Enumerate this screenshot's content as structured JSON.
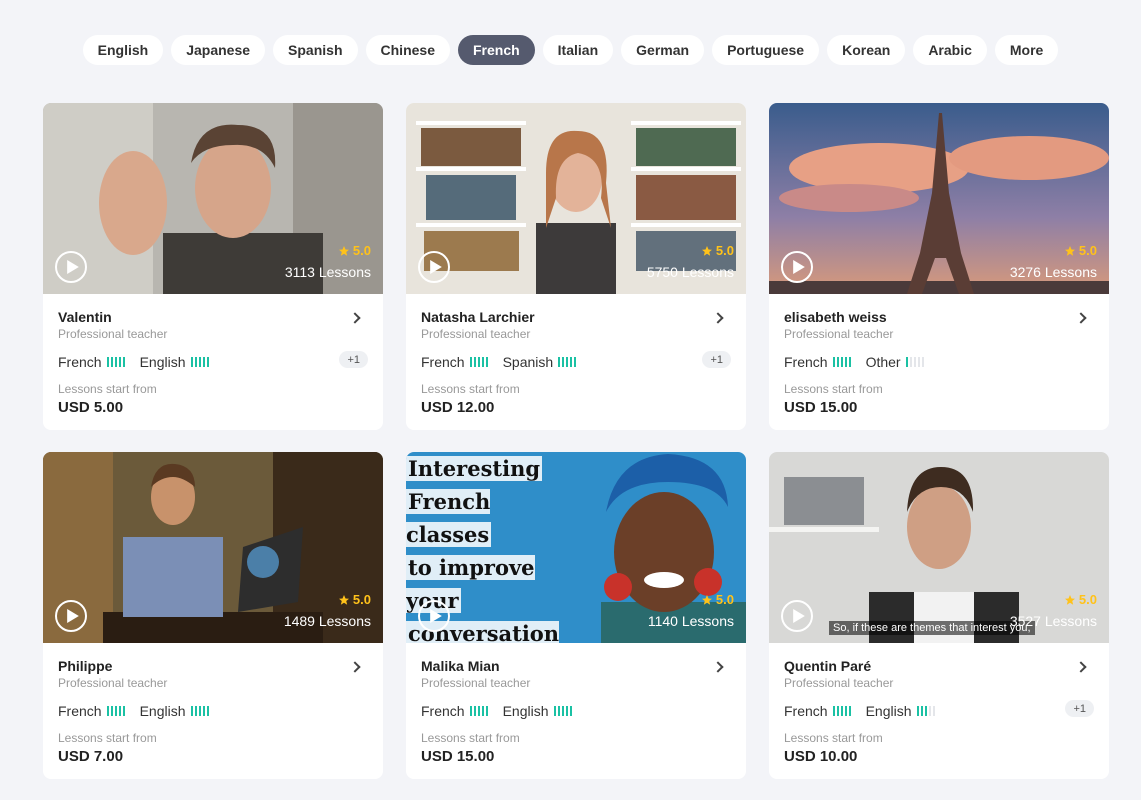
{
  "languages": [
    {
      "label": "English",
      "active": false
    },
    {
      "label": "Japanese",
      "active": false
    },
    {
      "label": "Spanish",
      "active": false
    },
    {
      "label": "Chinese",
      "active": false
    },
    {
      "label": "French",
      "active": true
    },
    {
      "label": "Italian",
      "active": false
    },
    {
      "label": "German",
      "active": false
    },
    {
      "label": "Portuguese",
      "active": false
    },
    {
      "label": "Korean",
      "active": false
    },
    {
      "label": "Arabic",
      "active": false
    },
    {
      "label": "More",
      "active": false
    }
  ],
  "colors": {
    "accent": "#1bc1a4",
    "active_pill": "#555a6e",
    "rating": "#ffc21a"
  },
  "teachers": [
    {
      "name": "Valentin",
      "title": "Professional teacher",
      "rating": "5.0",
      "lessons": "3113 Lessons",
      "languages": [
        {
          "label": "French",
          "level": 5
        },
        {
          "label": "English",
          "level": 5
        }
      ],
      "extra": "+1",
      "from_label": "Lessons start from",
      "price": "USD 5.00"
    },
    {
      "name": "Natasha Larchier",
      "title": "Professional teacher",
      "rating": "5.0",
      "lessons": "5750 Lessons",
      "languages": [
        {
          "label": "French",
          "level": 5
        },
        {
          "label": "Spanish",
          "level": 5
        }
      ],
      "extra": "+1",
      "from_label": "Lessons start from",
      "price": "USD 12.00"
    },
    {
      "name": "elisabeth weiss",
      "title": "Professional teacher",
      "rating": "5.0",
      "lessons": "3276 Lessons",
      "languages": [
        {
          "label": "French",
          "level": 5
        },
        {
          "label": "Other",
          "level": 1
        }
      ],
      "extra": "",
      "from_label": "Lessons start from",
      "price": "USD 15.00"
    },
    {
      "name": "Philippe",
      "title": "Professional teacher",
      "rating": "5.0",
      "lessons": "1489 Lessons",
      "languages": [
        {
          "label": "French",
          "level": 5
        },
        {
          "label": "English",
          "level": 5
        }
      ],
      "extra": "",
      "from_label": "Lessons start from",
      "price": "USD 7.00"
    },
    {
      "name": "Malika Mian",
      "title": "Professional teacher",
      "rating": "5.0",
      "lessons": "1140 Lessons",
      "languages": [
        {
          "label": "French",
          "level": 5
        },
        {
          "label": "English",
          "level": 5
        }
      ],
      "extra": "",
      "from_label": "Lessons start from",
      "price": "USD 15.00",
      "promo_lines": [
        "Interesting",
        "French classes",
        "to improve your",
        "conversation skills"
      ]
    },
    {
      "name": "Quentin Paré",
      "title": "Professional teacher",
      "rating": "5.0",
      "lessons": "3527 Lessons",
      "languages": [
        {
          "label": "French",
          "level": 5
        },
        {
          "label": "English",
          "level": 3
        }
      ],
      "extra": "+1",
      "from_label": "Lessons start from",
      "price": "USD 10.00",
      "caption": "So, if these are themes that interest you,"
    }
  ]
}
